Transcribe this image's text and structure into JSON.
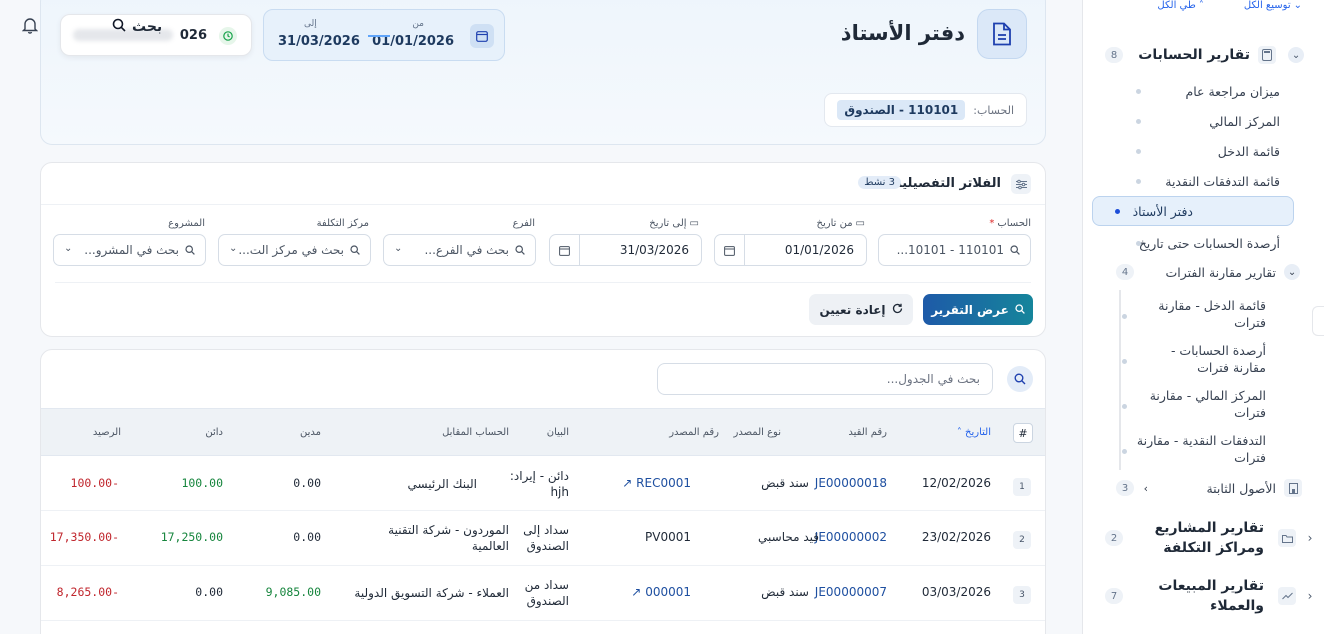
{
  "sidebar": {
    "expand_all": "توسيع الكل",
    "collapse_all": "طي الكل",
    "sections": [
      {
        "title": "تقارير الحسابات",
        "count": "8"
      },
      {
        "title": "تقارير المشاريع ومراكز التكلفة",
        "count": "2"
      },
      {
        "title": "تقارير المبيعات والعملاء",
        "count": "7"
      }
    ],
    "items": [
      {
        "label": "ميزان مراجعة عام"
      },
      {
        "label": "المركز المالي"
      },
      {
        "label": "قائمة الدخل"
      },
      {
        "label": "قائمة التدفقات النقدية"
      },
      {
        "label": "دفتر الأستاذ"
      },
      {
        "label": "أرصدة الحسابات حتى تاريخ"
      }
    ],
    "period_group": {
      "label": "تقارير مقارنة الفترات",
      "count": "4"
    },
    "period_items": [
      {
        "label": "قائمة الدخل - مقارنة فترات"
      },
      {
        "label": "أرصدة الحسابات - مقارنة فترات"
      },
      {
        "label": "المركز المالي - مقارنة فترات"
      },
      {
        "label": "التدفقات النقدية - مقارنة فترات"
      }
    ],
    "fixed_assets": {
      "label": "الأصول الثابتة",
      "count": "3"
    }
  },
  "header": {
    "title": "دفتر الأستاذ",
    "account_label": "الحساب:",
    "account_value": "110101 - الصندوق",
    "from_label": "من",
    "from_date": "01/01/2026",
    "to_label": "إلى",
    "to_date": "31/03/2026",
    "cash_value": "026",
    "search_label": "بحث"
  },
  "filters": {
    "title": "الفلاتر التفصيلية",
    "active_count": "3 نشط",
    "account": {
      "label": "الحساب",
      "required": "*",
      "value": "110101 - 10101..."
    },
    "from_date": {
      "label": "من تاريخ",
      "value": "01/01/2026"
    },
    "to_date": {
      "label": "إلى تاريخ",
      "value": "31/03/2026"
    },
    "branch": {
      "label": "الفرع",
      "placeholder": "بحث في الفرع..."
    },
    "cost_center": {
      "label": "مركز التكلفة",
      "placeholder": "بحث في مركز الت..."
    },
    "project": {
      "label": "المشروع",
      "placeholder": "بحث في المشرو..."
    },
    "show_report": "عرض التقرير",
    "reset": "إعادة تعيين"
  },
  "table": {
    "search_placeholder": "بحث في الجدول...",
    "headers": {
      "index": "#",
      "date": "التاريخ",
      "entry_no": "رقم القيد",
      "source_type": "نوع المصدر",
      "source_no": "رقم المصدر",
      "description": "البيان",
      "counter_account": "الحساب المقابل",
      "debit": "مدين",
      "credit": "دائن",
      "balance": "الرصيد"
    },
    "rows": [
      {
        "index": "1",
        "date": "12/02/2026",
        "entry_no": "JE00000018",
        "source_type": "سند قبض",
        "source_no": "REC0001",
        "description": "دائن - إيراد: hjh",
        "counter_account": "البنك الرئيسي",
        "debit": "0.00",
        "credit": "100.00",
        "balance": "-100.00"
      },
      {
        "index": "2",
        "date": "23/02/2026",
        "entry_no": "JE00000002",
        "source_type": "قيد محاسبي",
        "source_no": "PV0001",
        "description": "سداد إلى الصندوق",
        "counter_account": "الموردون - شركة التقنية العالمية",
        "debit": "0.00",
        "credit": "17,250.00",
        "balance": "-17,350.00"
      },
      {
        "index": "3",
        "date": "03/03/2026",
        "entry_no": "JE00000007",
        "source_type": "سند قبض",
        "source_no": "000001",
        "description": "سداد من الصندوق",
        "counter_account": "العملاء - شركة التسويق الدولية",
        "debit": "9,085.00",
        "credit": "0.00",
        "balance": "-8,265.00"
      }
    ]
  },
  "colors": {
    "accent": "#1e5aa8",
    "positive": "#16853d",
    "negative": "#c0262d"
  }
}
